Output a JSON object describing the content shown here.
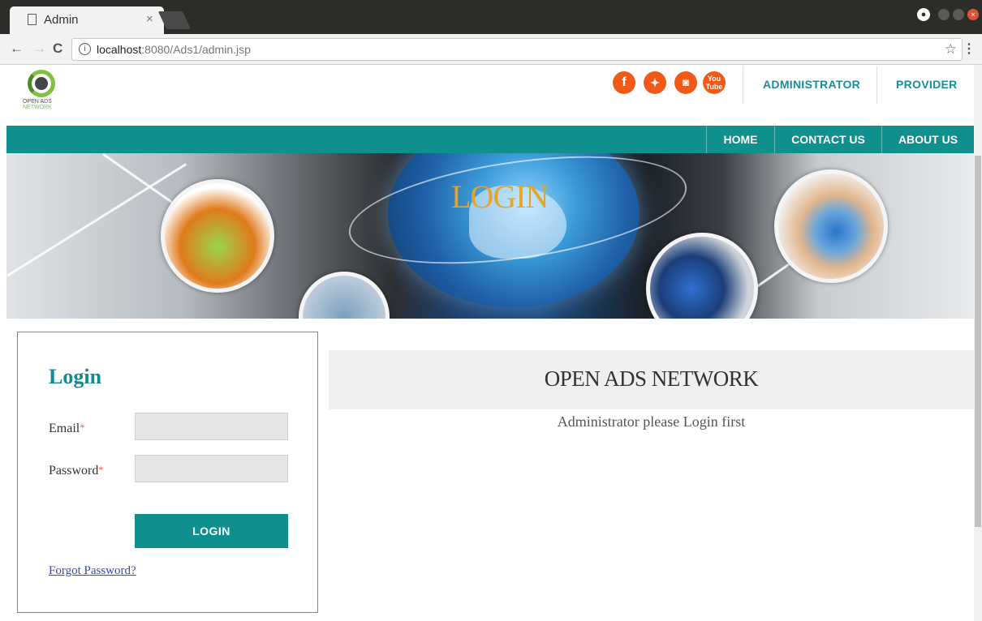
{
  "browser": {
    "tab_title": "Admin",
    "tab_close": "×",
    "url_host": "localhost",
    "url_path": ":8080/Ads1/admin.jsp",
    "icons": [
      "page-icon",
      "close-icon",
      "back-icon",
      "forward-icon",
      "reload-icon",
      "info-icon",
      "star-icon",
      "menu-icon",
      "account-icon"
    ]
  },
  "header": {
    "logo_line1": "OPEN ADS",
    "logo_line2": "NETWORK",
    "social": [
      {
        "name": "facebook",
        "glyph": "f"
      },
      {
        "name": "twitter",
        "glyph": "t"
      },
      {
        "name": "instagram",
        "glyph": "◙"
      },
      {
        "name": "youtube",
        "glyph": "You Tube"
      }
    ],
    "social_color": "#f05a18",
    "links": [
      "ADMINISTRATOR",
      "PROVIDER"
    ]
  },
  "nav": {
    "color": "#0f908e",
    "items": [
      "HOME",
      "CONTACT US",
      "ABOUT US"
    ]
  },
  "banner": {
    "title": "LOGIN"
  },
  "login": {
    "title": "Login",
    "email_label": "Email",
    "password_label": "Password",
    "required_mark": "*",
    "email_value": "",
    "password_value": "",
    "button_label": "LOGIN",
    "forgot_link": "Forgot Password?"
  },
  "main": {
    "heading": "OPEN ADS NETWORK",
    "message": "Administrator please Login first"
  }
}
